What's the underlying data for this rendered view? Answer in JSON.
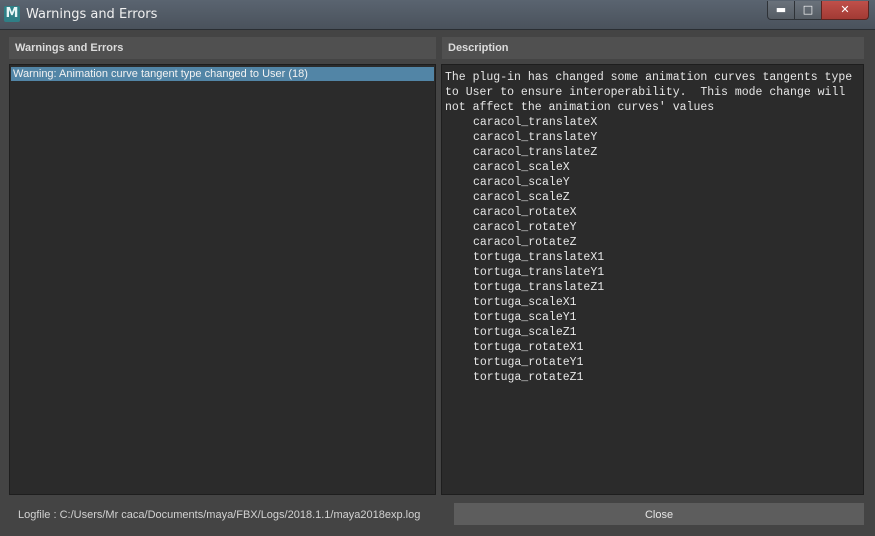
{
  "window": {
    "title": "Warnings and Errors",
    "icon_letter": "M",
    "minimize_glyph": "▬",
    "maximize_glyph": "□",
    "close_glyph": "✕"
  },
  "left_panel": {
    "header": "Warnings and Errors",
    "items": [
      {
        "label": "Warning: Animation curve tangent type changed to User (18)",
        "selected": true
      }
    ]
  },
  "right_panel": {
    "header": "Description",
    "text": "The plug-in has changed some animation curves tangents type\nto User to ensure interoperability.  This mode change will\nnot affect the animation curves' values",
    "curves": [
      "caracol_translateX",
      "caracol_translateY",
      "caracol_translateZ",
      "caracol_scaleX",
      "caracol_scaleY",
      "caracol_scaleZ",
      "caracol_rotateX",
      "caracol_rotateY",
      "caracol_rotateZ",
      "tortuga_translateX1",
      "tortuga_translateY1",
      "tortuga_translateZ1",
      "tortuga_scaleX1",
      "tortuga_scaleY1",
      "tortuga_scaleZ1",
      "tortuga_rotateX1",
      "tortuga_rotateY1",
      "tortuga_rotateZ1"
    ]
  },
  "footer": {
    "logfile": "Logfile : C:/Users/Mr caca/Documents/maya/FBX/Logs/2018.1.1/maya2018exp.log",
    "close_label": "Close"
  },
  "colors": {
    "selection": "#5285a6",
    "panel_bg": "#2b2b2b",
    "window_bg": "#444444"
  }
}
